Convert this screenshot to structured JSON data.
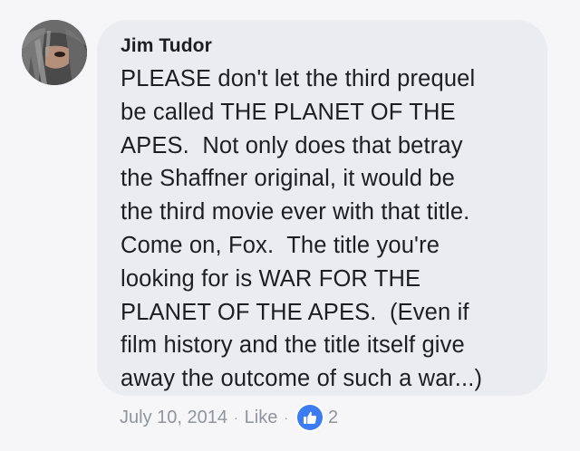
{
  "comment": {
    "author": "Jim Tudor",
    "lines": [
      "PLEASE don't let the third prequel",
      "be called THE PLANET OF THE",
      "APES.  Not only does that betray",
      "the Shaffner original, it would be",
      "the third movie ever with that title.",
      "Come on, Fox.  The title you're",
      "looking for is WAR FOR THE",
      "PLANET OF THE APES.  (Even if",
      "film history and the title itself give",
      "away the outcome of such a war...)"
    ],
    "date": "July 10, 2014",
    "separator": "·",
    "like_label": "Like",
    "reaction_icon": "thumbs-up-icon",
    "reaction_count": "2"
  },
  "colors": {
    "bubble": "#ebecf0",
    "text": "#1c1e21",
    "meta": "#90949c",
    "like_blue": "#3b7cf2"
  }
}
